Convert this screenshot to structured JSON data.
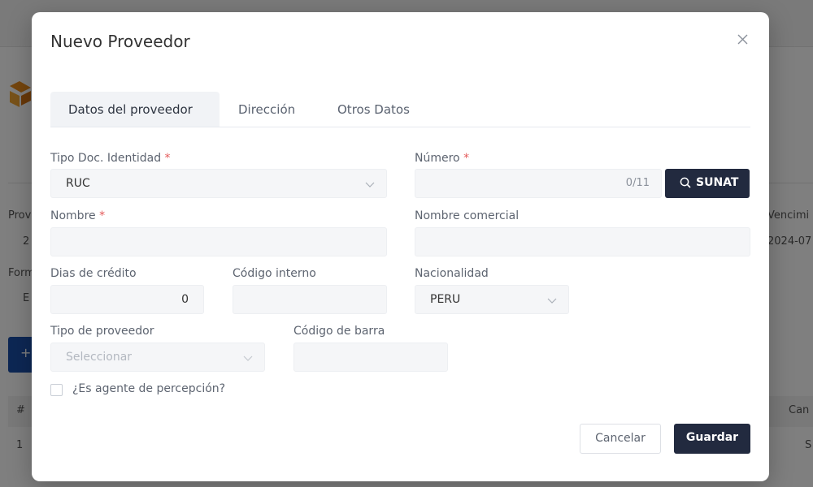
{
  "background": {
    "left_labels": [
      "Prov",
      "2",
      "Form",
      "E"
    ],
    "right_labels": [
      "Vencimi",
      "2024-07"
    ],
    "table": {
      "hash": "#",
      "row_num": "1",
      "right_head": "Can",
      "right_cell": "S"
    },
    "add_button_icon": "+"
  },
  "modal": {
    "title": "Nuevo Proveedor",
    "close_icon": "close-icon",
    "tabs": [
      {
        "label": "Datos del proveedor",
        "active": true
      },
      {
        "label": "Dirección",
        "active": false
      },
      {
        "label": "Otros Datos",
        "active": false
      }
    ],
    "required_mark": "*",
    "form": {
      "tipo_doc": {
        "label": "Tipo Doc. Identidad",
        "value": "RUC"
      },
      "numero": {
        "label": "Número",
        "value": "",
        "counter": "0/11"
      },
      "sunat_button": {
        "label": "SUNAT",
        "icon": "search-icon"
      },
      "nombre": {
        "label": "Nombre",
        "value": ""
      },
      "nombre_comercial": {
        "label": "Nombre comercial",
        "value": ""
      },
      "dias_credito": {
        "label": "Dias de crédito",
        "value": "0"
      },
      "codigo_interno": {
        "label": "Código interno",
        "value": ""
      },
      "nacionalidad": {
        "label": "Nacionalidad",
        "value": "PERU"
      },
      "tipo_proveedor": {
        "label": "Tipo de proveedor",
        "placeholder": "Seleccionar"
      },
      "codigo_barra": {
        "label": "Código de barra",
        "value": ""
      },
      "agente_percepcion": {
        "label": "¿Es agente de percepción?",
        "checked": false
      }
    },
    "buttons": {
      "cancel": "Cancelar",
      "save": "Guardar"
    }
  },
  "colors": {
    "primary_dark": "#222a3f",
    "required": "#e45a5a",
    "field_bg": "#f5f6f8"
  }
}
